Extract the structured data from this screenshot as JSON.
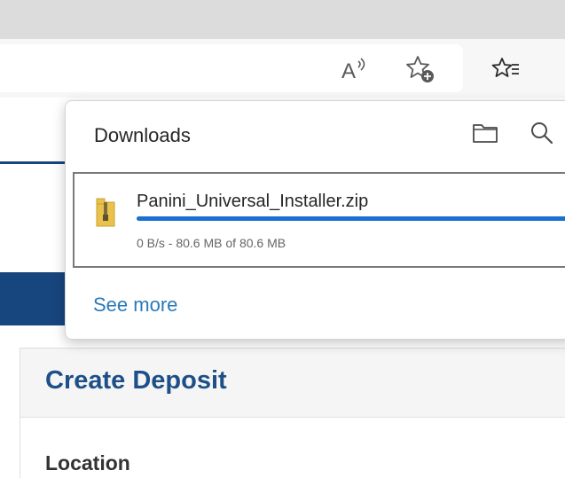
{
  "browser": {
    "toolbar": {
      "read_aloud_icon": "read-aloud-icon",
      "add_favorite_icon": "add-favorite-icon",
      "favorites_icon": "favorites-icon"
    }
  },
  "downloads": {
    "title": "Downloads",
    "open_folder_icon": "folder-icon",
    "search_icon": "search-icon",
    "items": [
      {
        "file_name": "Panini_Universal_Installer.zip",
        "file_icon": "zip-file-icon",
        "status": "0 B/s - 80.6 MB of 80.6 MB",
        "progress": 1.0
      }
    ],
    "see_more": "See more"
  },
  "page": {
    "card_title": "Create Deposit",
    "location_label": "Location"
  },
  "colors": {
    "accent": "#1a6fd0",
    "brand_navy": "#17457d",
    "link": "#2a7ab8"
  }
}
